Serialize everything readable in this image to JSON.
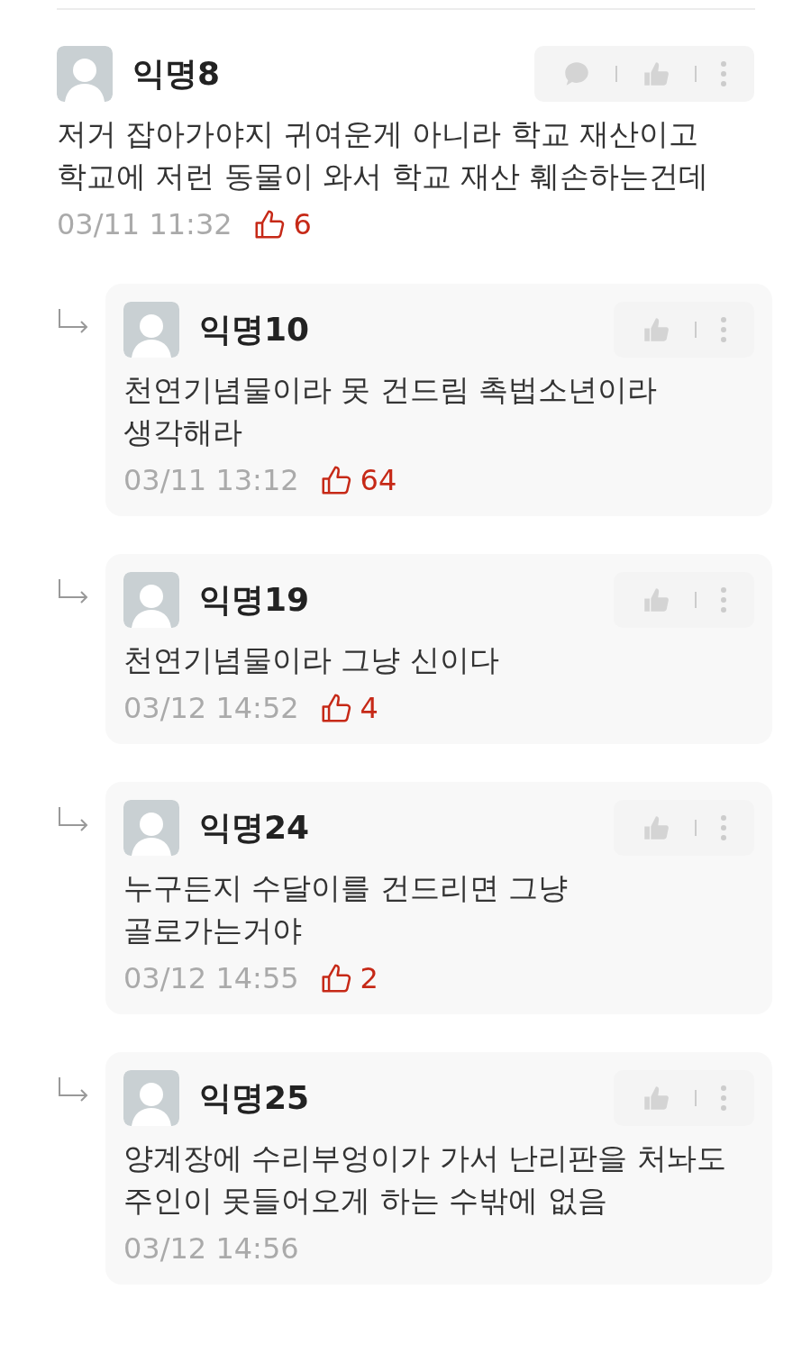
{
  "comments": [
    {
      "kind": "comment",
      "author": "익명8",
      "text": "저거 잡아가야지 귀여운게 아니라 학교 재산이고 학교에 저런 동물이 와서 학교 재산 훼손하는건데",
      "time": "03/11 11:32",
      "likes": "6"
    },
    {
      "kind": "reply",
      "author": "익명10",
      "text": "천연기념물이라 못 건드림 촉법소년이라 생각해라",
      "time": "03/11 13:12",
      "likes": "64"
    },
    {
      "kind": "reply",
      "author": "익명19",
      "text": "천연기념물이라 그냥 신이다",
      "time": "03/12 14:52",
      "likes": "4"
    },
    {
      "kind": "reply",
      "author": "익명24",
      "text": "누구든지 수달이를 건드리면 그냥 골로가는거야",
      "time": "03/12 14:55",
      "likes": "2"
    },
    {
      "kind": "reply",
      "author": "익명25",
      "text": "양계장에 수리부엉이가 가서 난리판을 처놔도 주인이 못들어오게 하는 수밖에 없음",
      "time": "03/12 14:56"
    }
  ]
}
